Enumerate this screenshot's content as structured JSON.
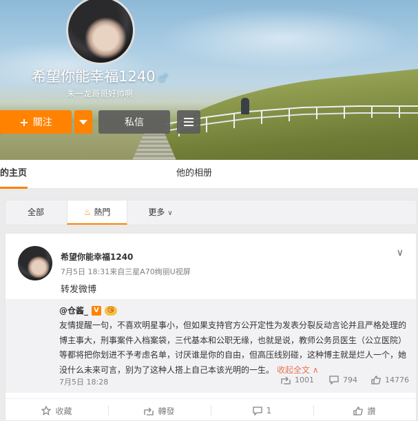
{
  "profile": {
    "name": "希望你能幸福1240",
    "gender_symbol": "♂",
    "subtitle": "朱一龙哥哥好帅啊",
    "follow_label": "關注",
    "message_label": "私信"
  },
  "tabs": {
    "home": "的主页",
    "album": "他的相册"
  },
  "filter": {
    "all": "全部",
    "hot": "熱門",
    "more": "更多"
  },
  "post": {
    "author": "希望你能幸福1240",
    "meta": "7月5日 18:31来自三星A70绚丽U视屏",
    "text": "转发微博",
    "repost": {
      "author": "@仓酱_",
      "badge_v": "V",
      "badge_p": "😘",
      "body": "友情提醒一句，不喜欢明星事小，但如果支持官方公开定性为发表分裂反动言论并且严格处理的博主事大，刑事案件入档案袋，三代基本和公职无缘，也就是说，教师公务员医生（公立医院）等都将把你划进不予考虑名单，讨厌谁是你的自由，但高压线别碰，这种博主就是烂人一个，她没什么未来可言，别为了这种人搭上自己本该光明的一生。",
      "collapse": "收起全文",
      "date": "7月5日 18:28",
      "reposts": "1001",
      "comments": "794",
      "likes": "14776"
    },
    "actions": {
      "collect": "收藏",
      "forward": "轉發",
      "comment": "1",
      "like": "讚"
    }
  },
  "colors": {
    "accent": "#ff8200",
    "link": "#eb7350"
  }
}
